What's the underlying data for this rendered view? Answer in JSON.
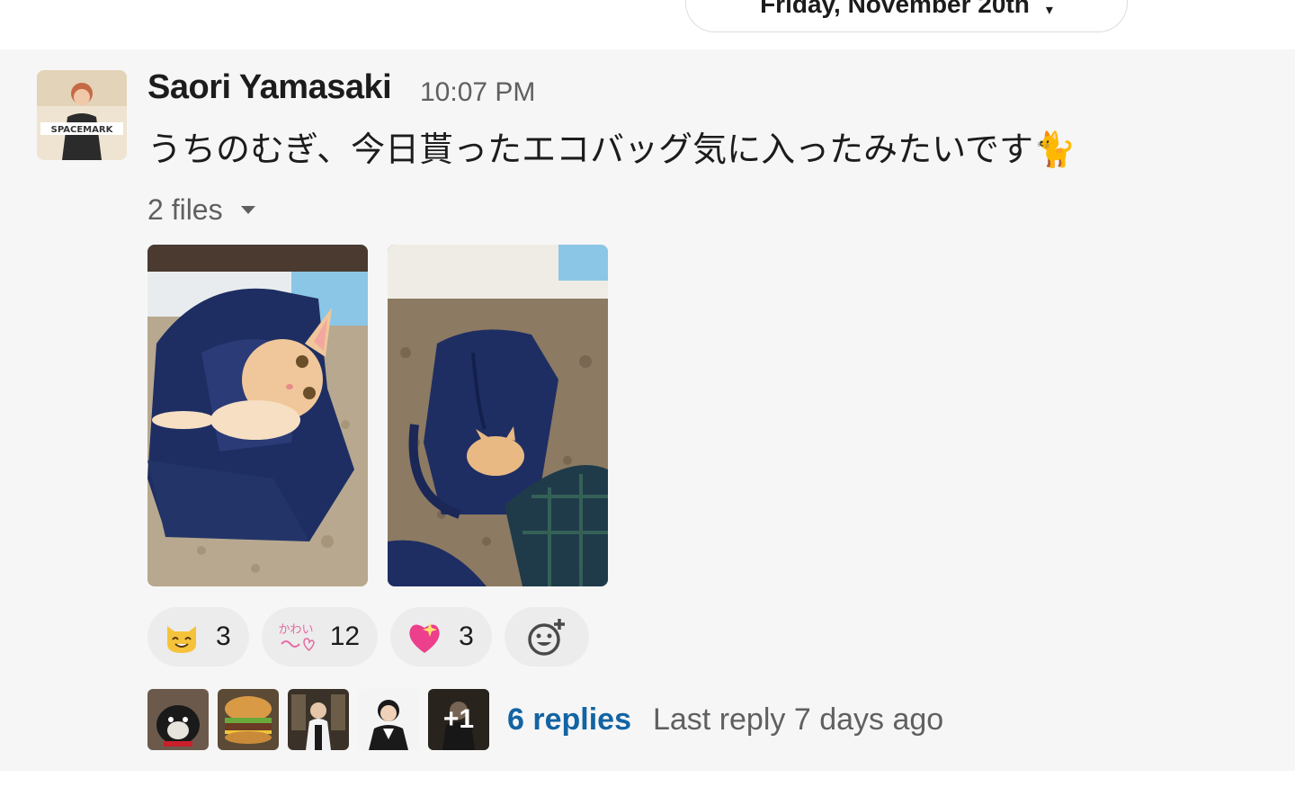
{
  "date_divider": {
    "label": "Friday, November 20th"
  },
  "message": {
    "sender": "Saori Yamasaki",
    "time": "10:07 PM",
    "text": "うちのむぎ、今日貰ったエコバッグ気に入ったみたいです🐈",
    "avatar_caption": "SPACEMARK"
  },
  "files": {
    "toggle_label": "2 files",
    "items": [
      {
        "kind": "image",
        "subject": "orange kitten lying in navy tote bag"
      },
      {
        "kind": "image",
        "subject": "kitten peeking from navy tote bag on rug"
      }
    ]
  },
  "reactions": [
    {
      "emoji": "smiley-cat",
      "count": "3"
    },
    {
      "emoji": "kawaii-custom",
      "count": "12"
    },
    {
      "emoji": "sparkling-heart",
      "count": "3"
    }
  ],
  "add_reaction": {
    "icon": "add-reaction-icon"
  },
  "thread": {
    "participants": [
      "dog",
      "burger",
      "person-1",
      "person-2",
      "person-3"
    ],
    "more_label": "+1",
    "replies_label": "6 replies",
    "last_reply": "Last reply 7 days ago"
  },
  "colors": {
    "accent_link": "#1264a3",
    "message_bg": "#f6f6f6",
    "reaction_bg": "#ececec"
  }
}
